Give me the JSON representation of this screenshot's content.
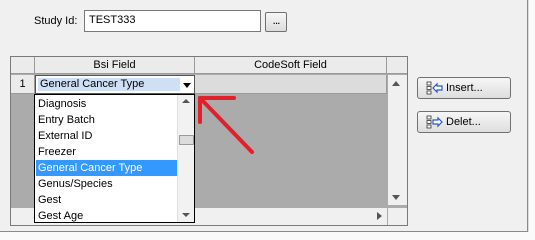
{
  "form": {
    "study_label": "Study Id:",
    "study_value": "TEST333",
    "browse_label": "..."
  },
  "grid": {
    "columns": [
      "Bsi Field",
      "CodeSoft Field"
    ],
    "rows": [
      {
        "num": "1",
        "bsi_field": "General Cancer Type",
        "codesoft_field": ""
      }
    ]
  },
  "dropdown": {
    "options": [
      "Diagnosis",
      "Entry Batch",
      "External ID",
      "Freezer",
      "General Cancer Type",
      "Genus/Species",
      "Gest",
      "Gest Age"
    ],
    "selected": "General Cancer Type"
  },
  "buttons": {
    "insert_label": "Insert...",
    "delete_label": "Delet..."
  },
  "colors": {
    "selection": "#3399ff",
    "annotation_arrow": "#e0202a"
  }
}
